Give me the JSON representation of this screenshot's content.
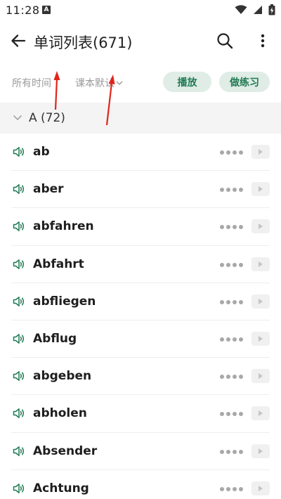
{
  "status_bar": {
    "time": "11:28",
    "notification_icon": "a-box-icon",
    "icons": [
      "wifi-icon",
      "signal-icon",
      "battery-charging-icon"
    ]
  },
  "app_bar": {
    "title": "单词列表(671)",
    "back_icon": "back-arrow-icon",
    "search_icon": "search-icon",
    "more_icon": "more-vertical-icon"
  },
  "filters": {
    "time_filter": "所有时间",
    "order_filter": "课本默认"
  },
  "actions": {
    "play_label": "播放",
    "practice_label": "做练习"
  },
  "group": {
    "label": "A (72)"
  },
  "words": [
    {
      "word": "ab",
      "familiarity": 4
    },
    {
      "word": "aber",
      "familiarity": 4
    },
    {
      "word": "abfahren",
      "familiarity": 4
    },
    {
      "word": "Abfahrt",
      "familiarity": 4
    },
    {
      "word": "abfliegen",
      "familiarity": 4
    },
    {
      "word": "Abflug",
      "familiarity": 4
    },
    {
      "word": "abgeben",
      "familiarity": 4
    },
    {
      "word": "abholen",
      "familiarity": 4
    },
    {
      "word": "Absender",
      "familiarity": 4
    },
    {
      "word": "Achtung",
      "familiarity": 4
    }
  ],
  "colors": {
    "accent": "#1f7a52",
    "pill_bg": "#e0ece6",
    "annotation_arrow": "#e0251b"
  }
}
